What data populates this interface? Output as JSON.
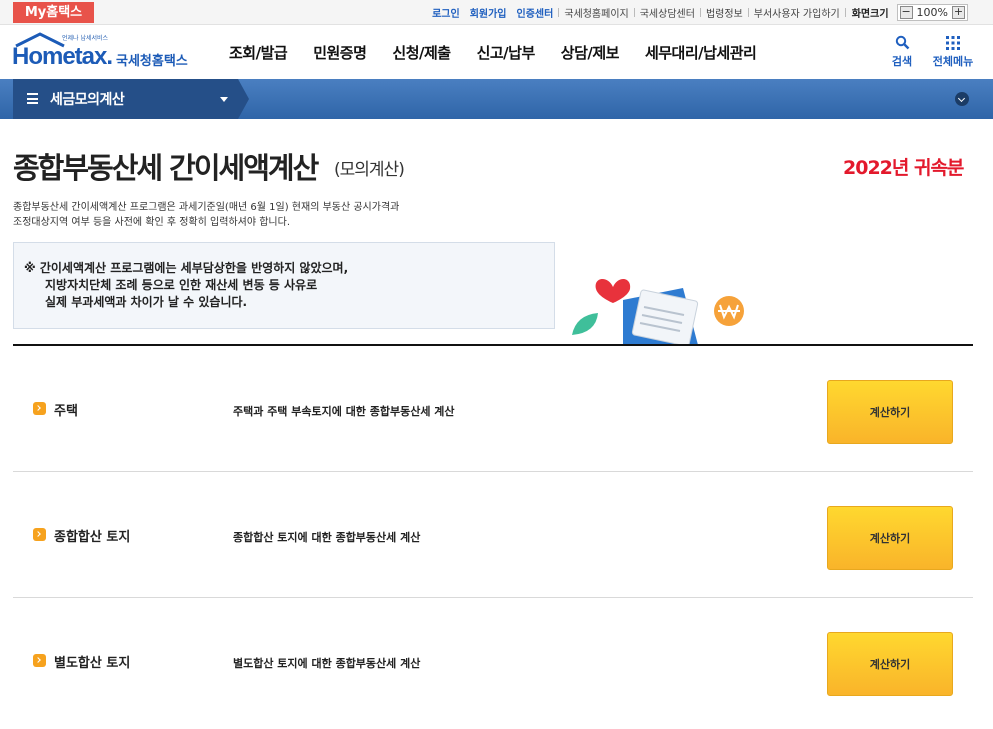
{
  "topbar": {
    "my_hometax": "My홈택스",
    "links": [
      "로그인",
      "회원가입",
      "인증센터",
      "국세청홈페이지",
      "국세상담센터",
      "법령정보",
      "부서사용자 가입하기"
    ],
    "zoom_label": "화면크기",
    "zoom_value": "100%",
    "zoom_minus": "−",
    "zoom_plus": "+"
  },
  "header": {
    "logo_small": "언제나 납세서비스",
    "logo_main": "Hometax.",
    "logo_kr": "국세청홈택스",
    "nav": [
      "조회/발급",
      "민원증명",
      "신청/제출",
      "신고/납부",
      "상담/제보",
      "세무대리/납세관리"
    ],
    "search_label": "검색",
    "allmenu_label": "전체메뉴"
  },
  "subbar": {
    "title": "세금모의계산"
  },
  "content": {
    "title": "종합부동산세 간이세액계산",
    "title_sub": "(모의계산)",
    "year": "2022년 귀속분",
    "intro_line1": "종합부동산세 간이세액계산 프로그램은 과세기준일(매년 6월 1일) 현재의 부동산 공시가격과",
    "intro_line2": "조정대상지역 여부 등을 사전에 확인 후 정확히 입력하셔야 합니다.",
    "notice_line1": "※ 간이세액계산 프로그램에는 세부담상한을 반영하지 않았으며,",
    "notice_line2": "지방자치단체 조례 등으로 인한 재산세 변동 등 사유로",
    "notice_line3": "실제 부과세액과 차이가 날 수 있습니다.",
    "rows": [
      {
        "name": "주택",
        "desc": "주택과 주택 부속토지에 대한 종합부동산세 계산",
        "button": "계산하기"
      },
      {
        "name": "종합합산 토지",
        "desc": "종합합산 토지에 대한 종합부동산세 계산",
        "button": "계산하기"
      },
      {
        "name": "별도합산 토지",
        "desc": "별도합산 토지에 대한 종합부동산세 계산",
        "button": "계산하기"
      }
    ]
  },
  "colors": {
    "brand_blue": "#1c5bb7",
    "accent_red": "#e3192c",
    "button_yellow": "#ffc928",
    "my_hometax_bg": "#e8534a"
  }
}
